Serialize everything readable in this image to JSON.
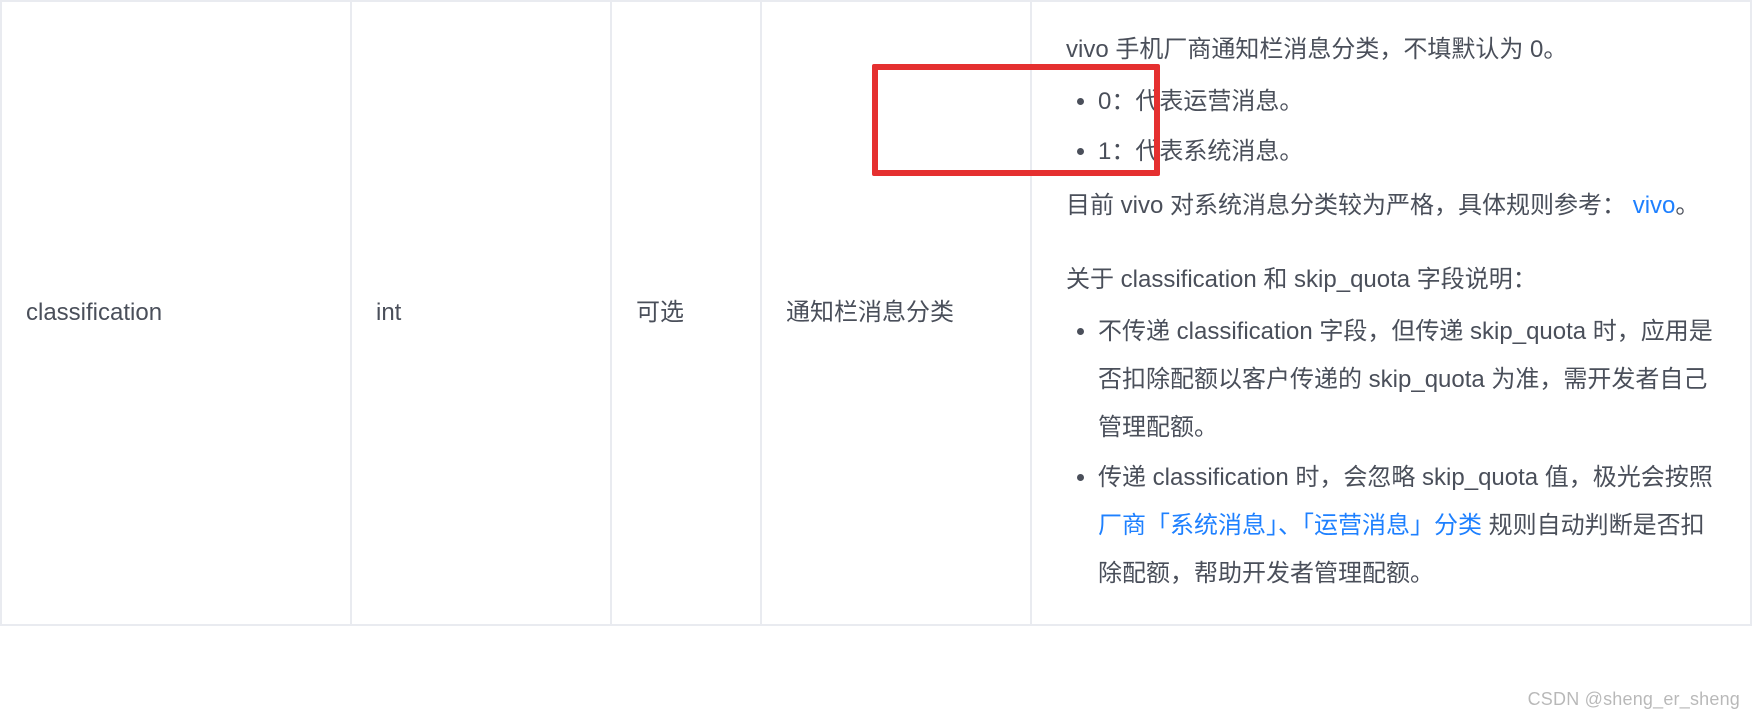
{
  "row": {
    "field": "classification",
    "type": "int",
    "required": "可选",
    "title": "通知栏消息分类"
  },
  "desc": {
    "intro": "vivo 手机厂商通知栏消息分类，不填默认为 0。",
    "opt0": "0：代表运营消息。",
    "opt1": "1：代表系统消息。",
    "rule_pre": "目前 vivo 对系统消息分类较为严格，具体规则参考：",
    "vivo_link": "vivo",
    "period": "。",
    "about": "关于 classification 和 skip_quota 字段说明：",
    "b1": "不传递 classification 字段，但传递 skip_quota 时，应用是否扣除配额以客户传递的 skip_quota 为准，需开发者自己管理配额。",
    "b2_pre": "传递 classification 时，会忽略 skip_quota 值，极光会按照 ",
    "b2_link": "厂商「系统消息」、「运营消息」分类",
    "b2_post": " 规则自动判断是否扣除配额，帮助开发者管理配额。"
  },
  "watermark": "CSDN @sheng_er_sheng"
}
